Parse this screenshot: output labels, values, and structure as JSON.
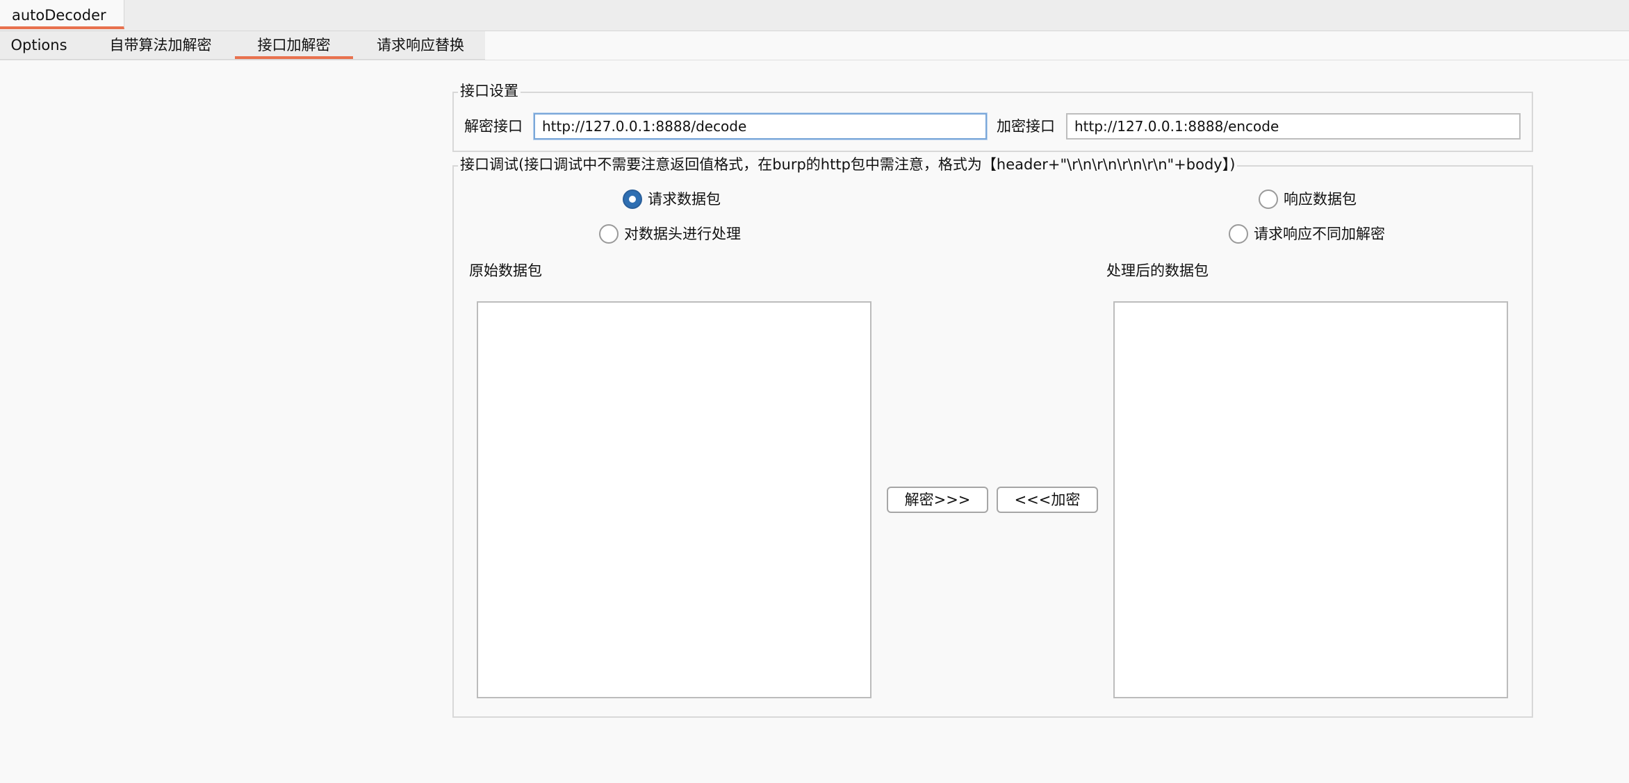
{
  "plugin_tab": {
    "label": "autoDecoder"
  },
  "subtabs": [
    {
      "label": "Options"
    },
    {
      "label": "自带算法加解密"
    },
    {
      "label": "接口加解密"
    },
    {
      "label": "请求响应替换"
    }
  ],
  "accent_color": "#e8714e",
  "interface_settings": {
    "legend": "接口设置",
    "decode_label": "解密接口",
    "decode_value": "http://127.0.0.1:8888/decode",
    "encode_label": "加密接口",
    "encode_value": "http://127.0.0.1:8888/encode"
  },
  "debug": {
    "legend": "接口调试(接口调试中不需要注意返回值格式，在burp的http包中需注意，格式为【header+\"\\r\\n\\r\\n\\r\\n\\r\\n\"+body】)",
    "radio_request": "请求数据包",
    "radio_response": "响应数据包",
    "radio_headers": "对数据头进行处理",
    "radio_diff": "请求响应不同加解密",
    "original_label": "原始数据包",
    "processed_label": "处理后的数据包",
    "decrypt_button": "解密>>>",
    "encrypt_button": "<<<加密",
    "original_content": "",
    "processed_content": ""
  }
}
